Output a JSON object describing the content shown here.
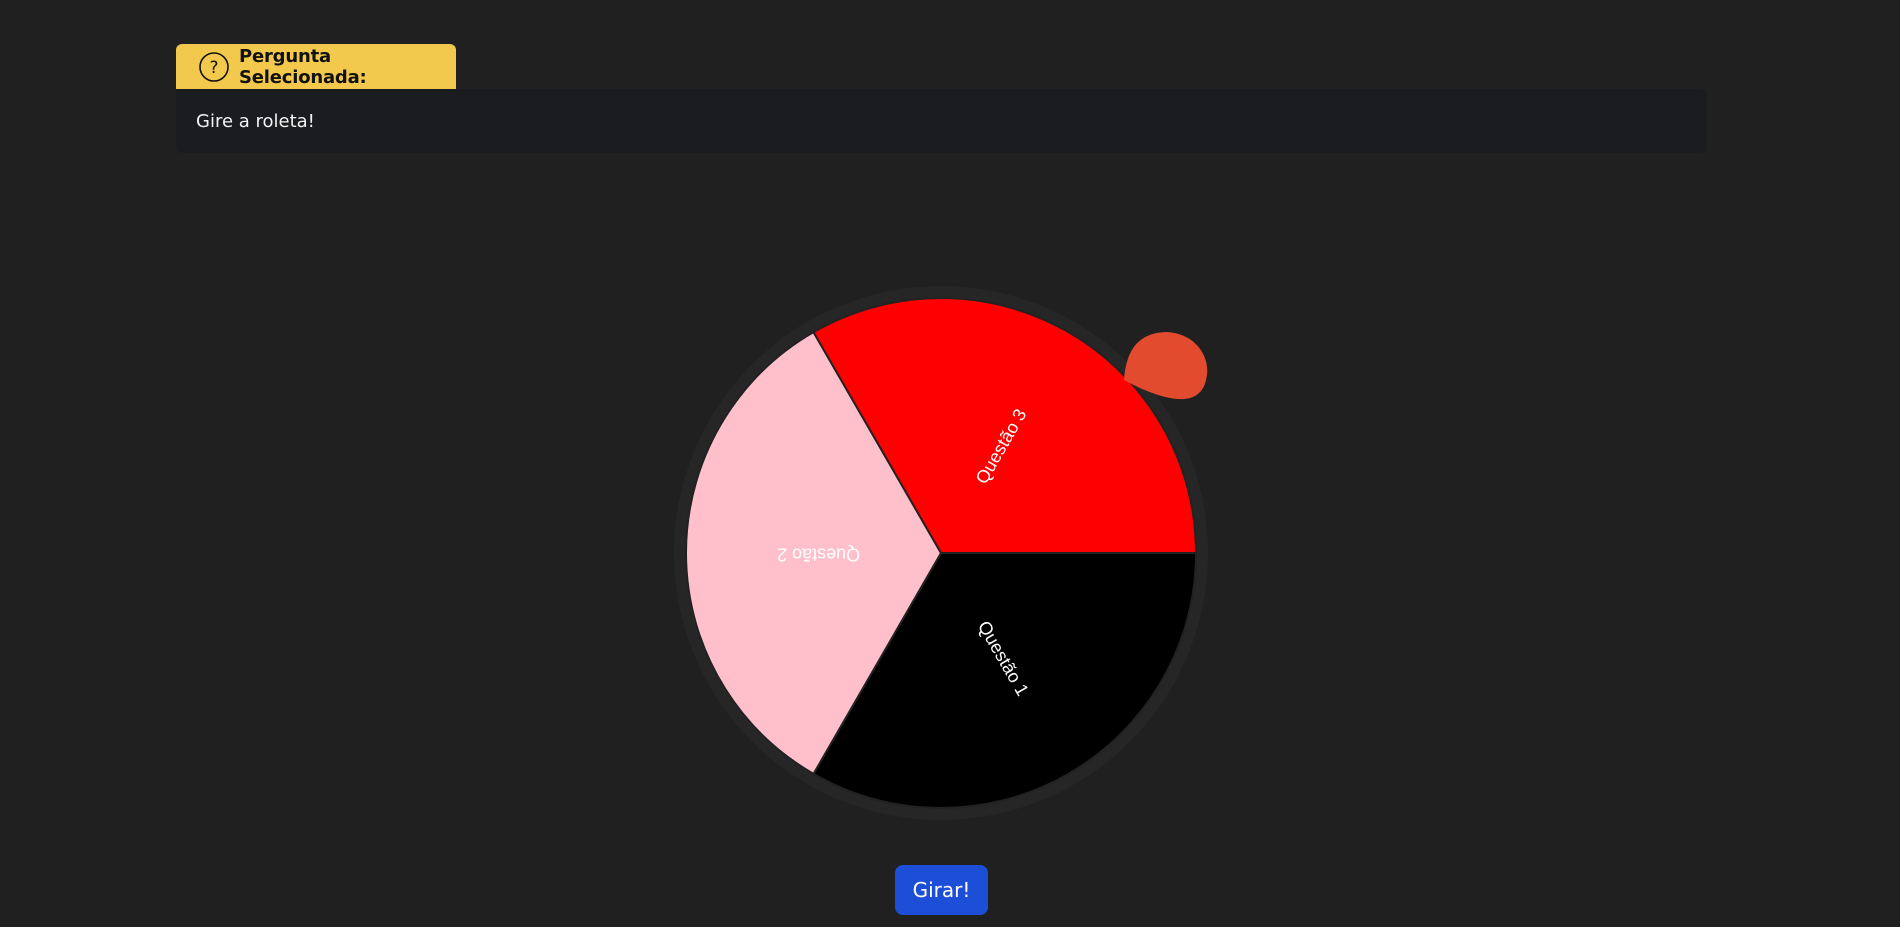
{
  "header": {
    "icon": "question-circle-icon",
    "title": "Pergunta Selecionada:"
  },
  "question": {
    "text": "Gire a roleta!"
  },
  "wheel": {
    "segments": [
      {
        "label": "Questão 1",
        "color": "#000000"
      },
      {
        "label": "Questão 2",
        "color": "#ffc0cb"
      },
      {
        "label": "Questão 3",
        "color": "#ff0000"
      }
    ],
    "pointer_color": "#e34b2f"
  },
  "controls": {
    "spin_label": "Girar!"
  },
  "colors": {
    "background": "#202020",
    "tab": "#f2c94c",
    "panel": "#1b1c1f",
    "button": "#1d4ed8"
  }
}
